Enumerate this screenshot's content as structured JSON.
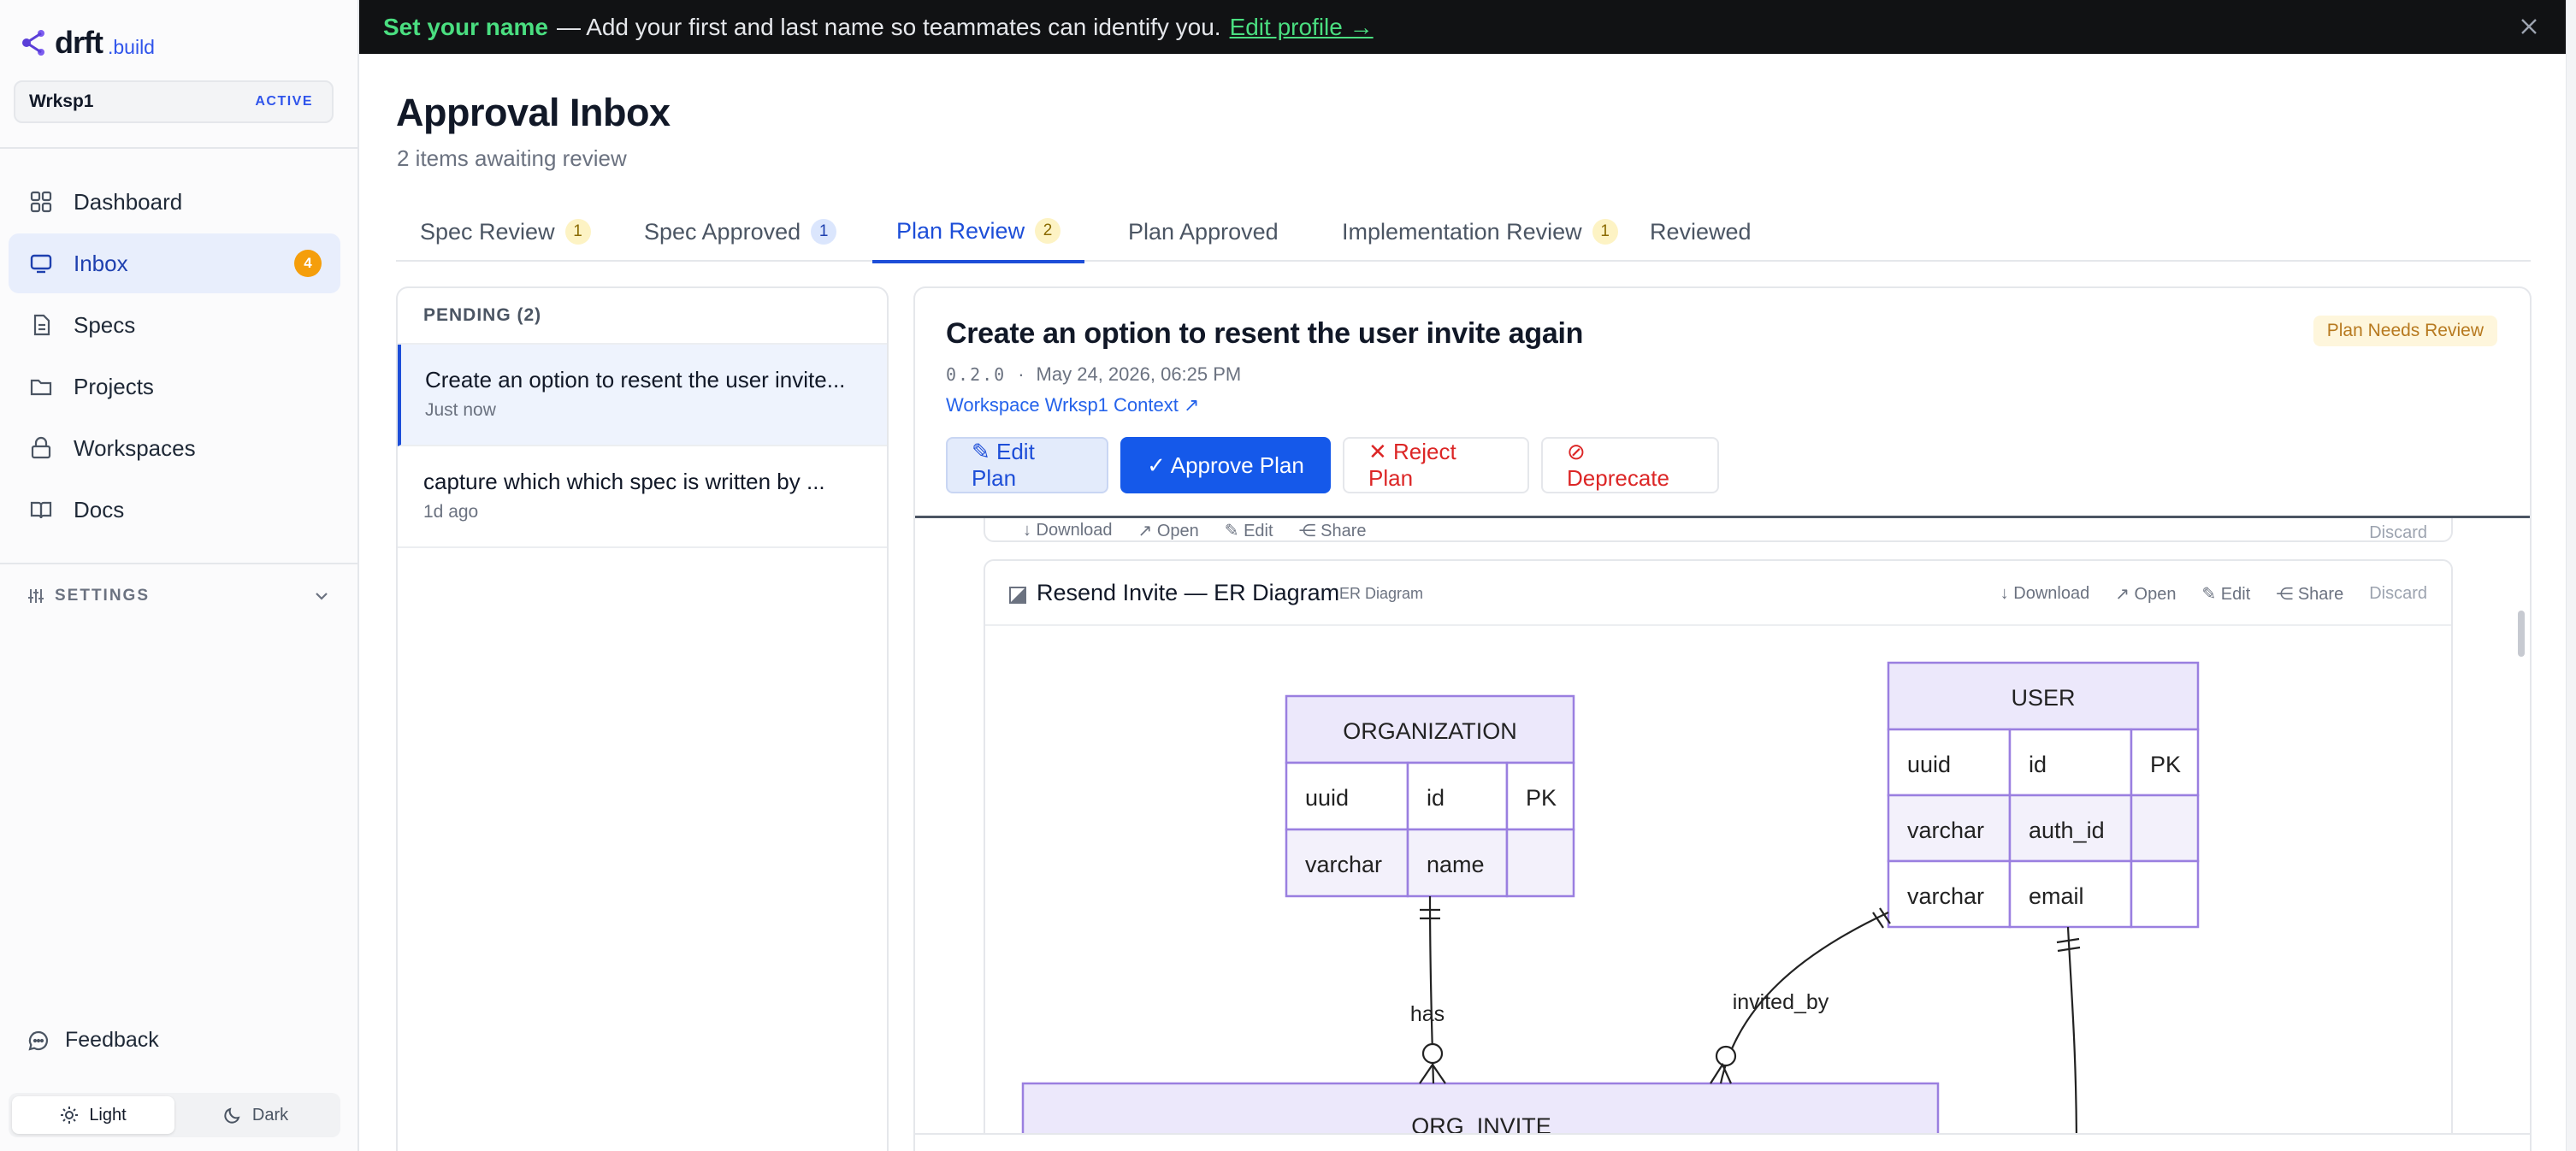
{
  "brand": {
    "name": "drft",
    "suffix": ".build"
  },
  "workspace": {
    "name": "Wrksp1",
    "badge": "ACTIVE"
  },
  "nav": [
    {
      "label": "Dashboard",
      "icon": "dashboard-icon"
    },
    {
      "label": "Inbox",
      "icon": "inbox-icon",
      "count": "4",
      "active": true
    },
    {
      "label": "Specs",
      "icon": "document-icon"
    },
    {
      "label": "Projects",
      "icon": "folder-icon"
    },
    {
      "label": "Workspaces",
      "icon": "lock-icon"
    },
    {
      "label": "Docs",
      "icon": "book-icon"
    }
  ],
  "settings": {
    "label": "SETTINGS"
  },
  "feedback": {
    "label": "Feedback"
  },
  "theme": {
    "light": "Light",
    "dark": "Dark",
    "selected": "Light"
  },
  "banner": {
    "strong": "Set your name",
    "text": "— Add your first and last name so teammates can identify you.",
    "link": "Edit profile →"
  },
  "page": {
    "title": "Approval Inbox",
    "subtitle": "2 items awaiting review"
  },
  "tabs": [
    {
      "label": "Spec Review",
      "count": "1"
    },
    {
      "label": "Spec Approved",
      "count": "1"
    },
    {
      "label": "Plan Review",
      "count": "2",
      "active": true
    },
    {
      "label": "Plan Approved",
      "count": ""
    },
    {
      "label": "Implementation Review",
      "count": "1"
    },
    {
      "label": "Reviewed",
      "count": ""
    }
  ],
  "pending": {
    "header": "PENDING (2)",
    "items": [
      {
        "title": "Create an option to resent the user invite...",
        "time": "Just now"
      },
      {
        "title": "capture which which spec is written by ...",
        "time": "1d ago"
      }
    ]
  },
  "detail": {
    "title": "Create an option to resent the user invite again",
    "status": "Plan Needs Review",
    "version": "0.2.0",
    "separator": "·",
    "date": "May 24, 2026, 06:25 PM",
    "context_link": "Workspace Wrksp1 Context ↗",
    "buttons": {
      "edit": "✎ Edit Plan",
      "approve": "✓ Approve Plan",
      "reject": "✕ Reject Plan",
      "deprecate": "⊘ Deprecate"
    }
  },
  "artifact_actions": {
    "download": "↓ Download",
    "open": "↗ Open",
    "edit": "✎ Edit",
    "share": "⋲ Share",
    "discard": "Discard"
  },
  "artifact": {
    "title": "Resend Invite — ER Diagram",
    "tag": "ER Diagram"
  },
  "er": {
    "organization": {
      "name": "ORGANIZATION",
      "rows": [
        [
          "uuid",
          "id",
          "PK"
        ],
        [
          "varchar",
          "name",
          ""
        ]
      ]
    },
    "user": {
      "name": "USER",
      "rows": [
        [
          "uuid",
          "id",
          "PK"
        ],
        [
          "varchar",
          "auth_id",
          ""
        ],
        [
          "varchar",
          "email",
          ""
        ]
      ]
    },
    "org_invite": {
      "name": "ORG_INVITE"
    },
    "rel_has": "has",
    "rel_invited_by": "invited_by"
  },
  "colors": {
    "accent": "#1d4ed8",
    "approve": "#1559ea",
    "danger": "#dc2626",
    "banner_bg": "#111214",
    "banner_highlight": "#4ade80",
    "er_fill": "#ece8fb",
    "er_border": "#9a7fe0"
  }
}
